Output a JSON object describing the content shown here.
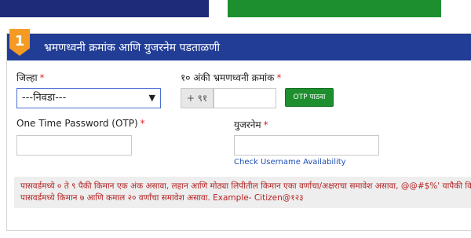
{
  "panel": {
    "step_number": "1",
    "title": "भ्रमणध्वनी क्रमांक आणि युजरनेम पडताळणी"
  },
  "district": {
    "label": "जिल्हा",
    "required_mark": "*",
    "selected": "---निवडा---"
  },
  "mobile": {
    "label": "१० अंकी भ्रमणध्वनी क्रमांक",
    "required_mark": "*",
    "prefix": "+ ९१",
    "value": ""
  },
  "otp_button": {
    "label": "OTP पाठवा"
  },
  "otp": {
    "label": "One Time Password (OTP)",
    "required_mark": "*",
    "value": ""
  },
  "username": {
    "label": "युजरनेम",
    "required_mark": "*",
    "value": ""
  },
  "availability_link": "Check Username Availability",
  "password_note": {
    "line1": "पासवर्डमध्ये ० ते ९ पैकी किमान एक अंक असावा, लहान आणि मोठ्या लिपीतील किमान एका वर्णाचा/अक्षराचा समावेश असावा, @@#$%' यापैकी कि",
    "line2": "पासवर्डमध्ये किमान ७ आणि कमाल २० वर्णांचा समावेश असावा. Example- Citizen@१२३"
  },
  "colors": {
    "header_blue": "#223d96",
    "accent_orange": "#f59a23",
    "button_green": "#1e8f2f",
    "note_red": "#b42323",
    "link_blue": "#1f4fb5"
  }
}
